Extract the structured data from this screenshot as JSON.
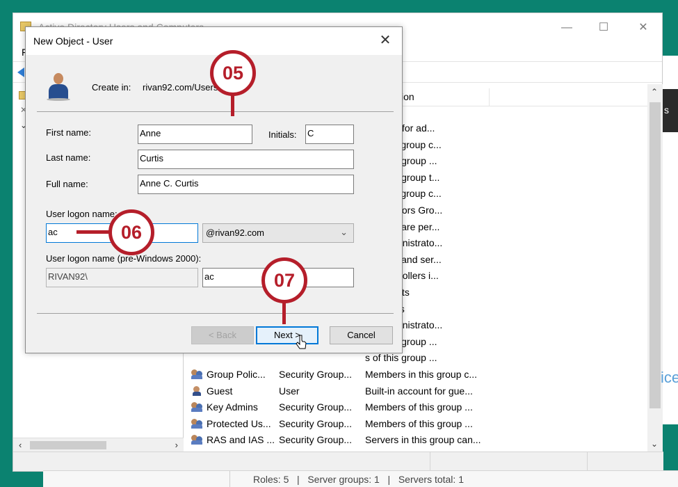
{
  "ad_window": {
    "title": "Active Directory Users and Computers",
    "menu_first_letter": "F",
    "window_controls": {
      "minimize": "—",
      "maximize": "☐",
      "close": "✕"
    },
    "column_header_partial": "ion",
    "rows": [
      {
        "name": "",
        "type": "",
        "description": "account for ad..."
      },
      {
        "name": "",
        "type": "",
        "description": "s in this group c..."
      },
      {
        "name": "",
        "type": "",
        "description": "s of this group ..."
      },
      {
        "name": "",
        "type": "",
        "description": "s of this group t..."
      },
      {
        "name": "",
        "type": "",
        "description": "s in this group c..."
      },
      {
        "name": "",
        "type": "",
        "description": "ministrators Gro..."
      },
      {
        "name": "",
        "type": "",
        "description": "nts who are per..."
      },
      {
        "name": "",
        "type": "",
        "description": "ted administrato..."
      },
      {
        "name": "",
        "type": "",
        "description": "stations and ser..."
      },
      {
        "name": "",
        "type": "",
        "description": "ain controllers i..."
      },
      {
        "name": "",
        "type": "",
        "description": "ain guests"
      },
      {
        "name": "",
        "type": "",
        "description": "ain users"
      },
      {
        "name": "",
        "type": "",
        "description": "ted administrato..."
      },
      {
        "name": "",
        "type": "",
        "description": "s of this group ..."
      },
      {
        "name": "",
        "type": "",
        "description": "s of this group ..."
      },
      {
        "name": "Group Polic...",
        "type": "Security Group...",
        "description": "Members in this group c...",
        "icon": "group-icon"
      },
      {
        "name": "Guest",
        "type": "User",
        "description": "Built-in account for gue...",
        "icon": "user-icon"
      },
      {
        "name": "Key Admins",
        "type": "Security Group...",
        "description": "Members of this group ...",
        "icon": "group-icon"
      },
      {
        "name": "Protected Us...",
        "type": "Security Group...",
        "description": "Members of this group ...",
        "icon": "group-icon"
      },
      {
        "name": "RAS and IAS ...",
        "type": "Security Group...",
        "description": "Servers in this group can...",
        "icon": "group-icon"
      },
      {
        "name": "Read-only D...",
        "type": "Security Group...",
        "description": "Members of this group ...",
        "icon": "group-icon"
      }
    ],
    "right_strip_letter": "s",
    "right_strip_text": "ice"
  },
  "footer": {
    "roles": "Roles: 5",
    "sep1": "|",
    "server_groups": "Server groups: 1",
    "sep2": "|",
    "servers_total": "Servers total: 1"
  },
  "dialog": {
    "title": "New Object - User",
    "close_glyph": "✕",
    "create_in_label": "Create in:",
    "create_in_value": "rivan92.com/Users",
    "first_name_label": "First name:",
    "first_name_value": "Anne",
    "initials_label": "Initials:",
    "initials_value": "C",
    "last_name_label": "Last name:",
    "last_name_value": "Curtis",
    "full_name_label": "Full name:",
    "full_name_value": "Anne C. Curtis",
    "logon_name_label": "User logon name:",
    "logon_name_value": "ac",
    "domain_value": "@rivan92.com",
    "pre2000_label": "User logon name (pre-Windows 2000):",
    "pre2000_domain": "RIVAN92\\",
    "pre2000_value": "ac",
    "back_button": "< Back",
    "next_button": "Next >",
    "cancel_button": "Cancel"
  },
  "callouts": {
    "c05": "05",
    "c06": "06",
    "c07": "07"
  },
  "colors": {
    "callout": "#b51e2a",
    "background": "#0b8270",
    "accent": "#0078d7"
  }
}
